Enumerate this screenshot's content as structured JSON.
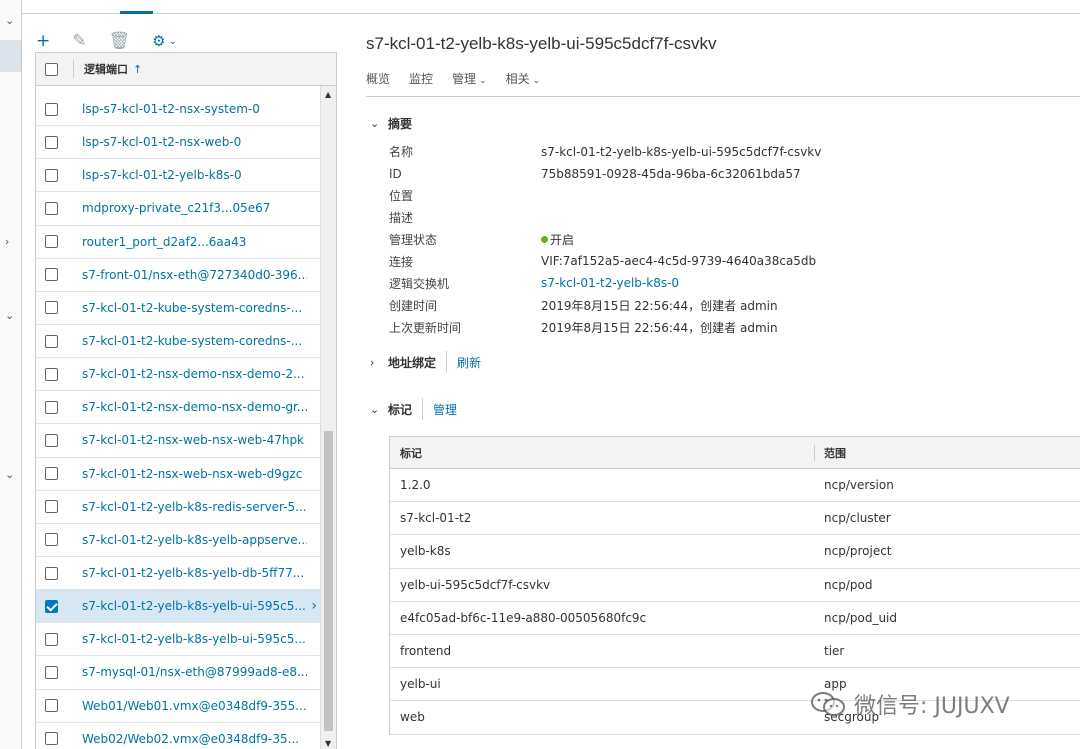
{
  "toolbar": {
    "add_icon": "plus-icon",
    "edit_icon": "pencil-icon",
    "delete_icon": "trash-icon",
    "settings_icon": "gear-icon"
  },
  "grid": {
    "header_label": "逻辑端口",
    "sort_indicator": "↑",
    "rows": [
      {
        "name": "lsp-s7-kcl-01-t2-nsx-system-0",
        "checked": false
      },
      {
        "name": "lsp-s7-kcl-01-t2-nsx-web-0",
        "checked": false
      },
      {
        "name": "lsp-s7-kcl-01-t2-yelb-k8s-0",
        "checked": false
      },
      {
        "name": "mdproxy-private_c21f3...05e67",
        "checked": false
      },
      {
        "name": "router1_port_d2af2...6aa43",
        "checked": false
      },
      {
        "name": "s7-front-01/nsx-eth@727340d0-396...",
        "checked": false
      },
      {
        "name": "s7-kcl-01-t2-kube-system-coredns-...",
        "checked": false
      },
      {
        "name": "s7-kcl-01-t2-kube-system-coredns-...",
        "checked": false
      },
      {
        "name": "s7-kcl-01-t2-nsx-demo-nsx-demo-2...",
        "checked": false
      },
      {
        "name": "s7-kcl-01-t2-nsx-demo-nsx-demo-gr...",
        "checked": false
      },
      {
        "name": "s7-kcl-01-t2-nsx-web-nsx-web-47hpk",
        "checked": false
      },
      {
        "name": "s7-kcl-01-t2-nsx-web-nsx-web-d9gzc",
        "checked": false
      },
      {
        "name": "s7-kcl-01-t2-yelb-k8s-redis-server-5...",
        "checked": false
      },
      {
        "name": "s7-kcl-01-t2-yelb-k8s-yelb-appserve...",
        "checked": false
      },
      {
        "name": "s7-kcl-01-t2-yelb-k8s-yelb-db-5ff77...",
        "checked": false
      },
      {
        "name": "s7-kcl-01-t2-yelb-k8s-yelb-ui-595c5...",
        "checked": true
      },
      {
        "name": "s7-kcl-01-t2-yelb-k8s-yelb-ui-595c5...",
        "checked": false
      },
      {
        "name": "s7-mysql-01/nsx-eth@87999ad8-e8...",
        "checked": false
      },
      {
        "name": "Web01/Web01.vmx@e0348df9-355...",
        "checked": false
      },
      {
        "name": "Web02/Web02.vmx@e0348df9-35...",
        "checked": false
      }
    ]
  },
  "detail": {
    "title": "s7-kcl-01-t2-yelb-k8s-yelb-ui-595c5dcf7f-csvkv",
    "tabs": [
      {
        "label": "概览",
        "caret": ""
      },
      {
        "label": "监控",
        "caret": ""
      },
      {
        "label": "管理",
        "caret": "⌄"
      },
      {
        "label": "相关",
        "caret": "⌄"
      }
    ],
    "summary": {
      "heading": "摘要",
      "props": [
        {
          "key": "名称",
          "value": "s7-kcl-01-t2-yelb-k8s-yelb-ui-595c5dcf7f-csvkv"
        },
        {
          "key": "ID",
          "value": "75b88591-0928-45da-96ba-6c32061bda57"
        },
        {
          "key": "位置",
          "value": ""
        },
        {
          "key": "描述",
          "value": ""
        },
        {
          "key": "管理状态",
          "value": "开启"
        },
        {
          "key": "连接",
          "value": "VIF:7af152a5-aec4-4c5d-9739-4640a38ca5db"
        },
        {
          "key": "逻辑交换机",
          "value": "s7-kcl-01-t2-yelb-k8s-0"
        },
        {
          "key": "创建时间",
          "value": "2019年8月15日 22:56:44，创建者 admin"
        },
        {
          "key": "上次更新时间",
          "value": "2019年8月15日 22:56:44，创建者 admin"
        }
      ]
    },
    "address_binding": {
      "heading": "地址绑定",
      "action": "刷新"
    },
    "tags": {
      "heading": "标记",
      "action": "管理",
      "col_tag": "标记",
      "col_scope": "范围",
      "rows": [
        {
          "tag": "1.2.0",
          "scope": "ncp/version"
        },
        {
          "tag": "s7-kcl-01-t2",
          "scope": "ncp/cluster"
        },
        {
          "tag": "yelb-k8s",
          "scope": "ncp/project"
        },
        {
          "tag": "yelb-ui-595c5dcf7f-csvkv",
          "scope": "ncp/pod"
        },
        {
          "tag": "e4fc05ad-bf6c-11e9-a880-00505680fc9c",
          "scope": "ncp/pod_uid"
        },
        {
          "tag": "frontend",
          "scope": "tier"
        },
        {
          "tag": "yelb-ui",
          "scope": "app"
        },
        {
          "tag": "web",
          "scope": "secgroup"
        }
      ]
    }
  },
  "watermark": {
    "text": "微信号: JUJUXV"
  },
  "colors": {
    "accent": "#0072a3",
    "status_green": "#60b515",
    "selected_row": "#d7e7f3"
  }
}
